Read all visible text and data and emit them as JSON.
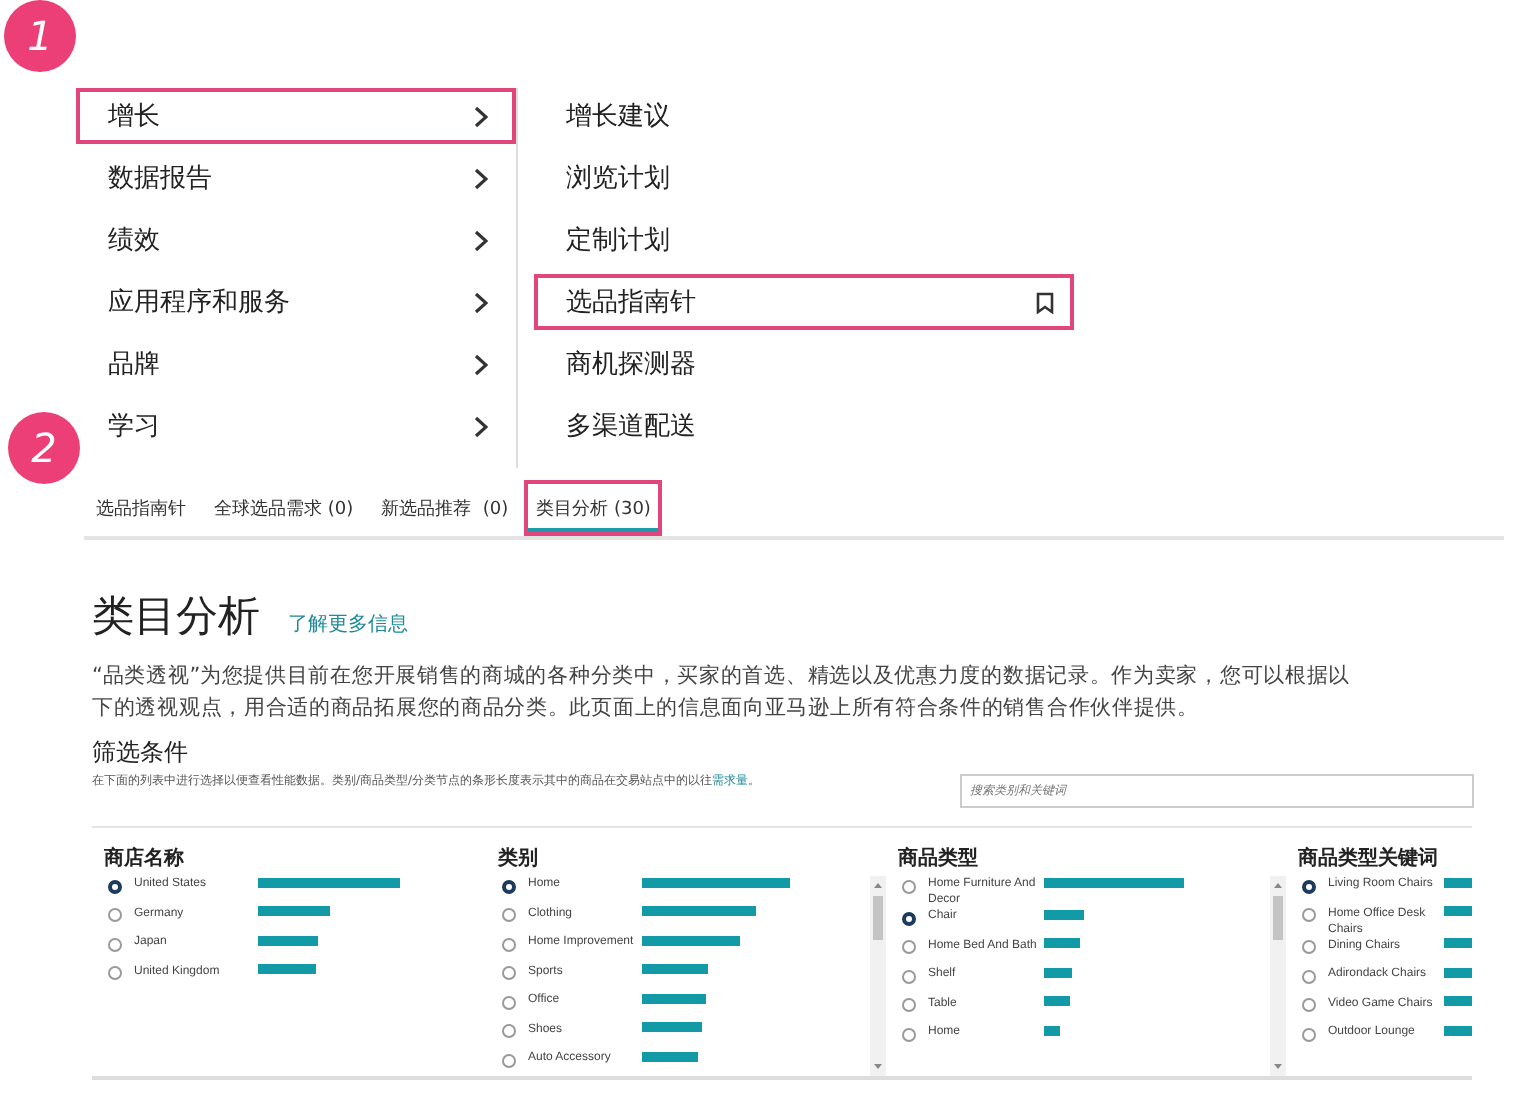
{
  "annotations": [
    {
      "label": "1"
    },
    {
      "label": "2"
    }
  ],
  "menu": {
    "items": [
      {
        "label": "增长",
        "highlighted": true
      },
      {
        "label": "数据报告",
        "highlighted": false
      },
      {
        "label": "绩效",
        "highlighted": false
      },
      {
        "label": "应用程序和服务",
        "highlighted": false
      },
      {
        "label": "品牌",
        "highlighted": false
      },
      {
        "label": "学习",
        "highlighted": false
      }
    ]
  },
  "submenu": {
    "items": [
      {
        "label": "增长建议",
        "highlighted": false,
        "bookmark": false
      },
      {
        "label": "浏览计划",
        "highlighted": false,
        "bookmark": false
      },
      {
        "label": "定制计划",
        "highlighted": false,
        "bookmark": false
      },
      {
        "label": "选品指南针",
        "highlighted": true,
        "bookmark": true
      },
      {
        "label": "商机探测器",
        "highlighted": false,
        "bookmark": false
      },
      {
        "label": "多渠道配送",
        "highlighted": false,
        "bookmark": false
      }
    ]
  },
  "tabs": [
    {
      "label": "选品指南针",
      "selected": false,
      "highlighted": false
    },
    {
      "label": "全球选品需求 (0)",
      "selected": false,
      "highlighted": false
    },
    {
      "label": "新选品推荐  (0)",
      "selected": false,
      "highlighted": false
    },
    {
      "label": "类目分析 (30)",
      "selected": true,
      "highlighted": true
    }
  ],
  "page": {
    "title": "类目分析",
    "link": "了解更多信息",
    "description": "“品类透视”为您提供目前在您开展销售的商城的各种分类中，买家的首选、精选以及优惠力度的数据记录。作为卖家，您可以根据以下的透视观点，用合适的商品拓展您的商品分类。此页面上的信息面向亚马逊上所有符合条件的销售合作伙伴提供。"
  },
  "filters": {
    "title": "筛选条件",
    "description": "在下面的列表中进行选择以便查看性能数据。类别/商品类型/分类节点的条形长度表示其中的商品在交易站点中的以往",
    "description_link": "需求量",
    "description_end": "。",
    "search": {
      "placeholder": "搜索类别和关键词"
    },
    "columns": [
      {
        "header": "商店名称",
        "scrollable": false,
        "options": [
          {
            "label": "United States",
            "selected": true
          },
          {
            "label": "Germany",
            "selected": false
          },
          {
            "label": "Japan",
            "selected": false
          },
          {
            "label": "United Kingdom",
            "selected": false
          }
        ]
      },
      {
        "header": "类别",
        "scrollable": true,
        "options": [
          {
            "label": "Home",
            "selected": true
          },
          {
            "label": "Clothing",
            "selected": false
          },
          {
            "label": "Home Improvement",
            "selected": false
          },
          {
            "label": "Sports",
            "selected": false
          },
          {
            "label": "Office",
            "selected": false
          },
          {
            "label": "Shoes",
            "selected": false
          },
          {
            "label": "Auto Accessory",
            "selected": false
          }
        ]
      },
      {
        "header": "商品类型",
        "scrollable": true,
        "options": [
          {
            "label": "Home Furniture And Decor",
            "selected": false
          },
          {
            "label": "Chair",
            "selected": true
          },
          {
            "label": "Home Bed And Bath",
            "selected": false
          },
          {
            "label": "Shelf",
            "selected": false
          },
          {
            "label": "Table",
            "selected": false
          },
          {
            "label": "Home",
            "selected": false
          }
        ]
      },
      {
        "header": "商品类型关键词",
        "scrollable": false,
        "options": [
          {
            "label": "Living Room Chairs",
            "selected": true
          },
          {
            "label": "Home Office Desk Chairs",
            "selected": false
          },
          {
            "label": "Dining Chairs",
            "selected": false
          },
          {
            "label": "Adirondack Chairs",
            "selected": false
          },
          {
            "label": "Video Game Chairs",
            "selected": false
          },
          {
            "label": "Outdoor Lounge",
            "selected": false
          }
        ]
      }
    ]
  }
}
